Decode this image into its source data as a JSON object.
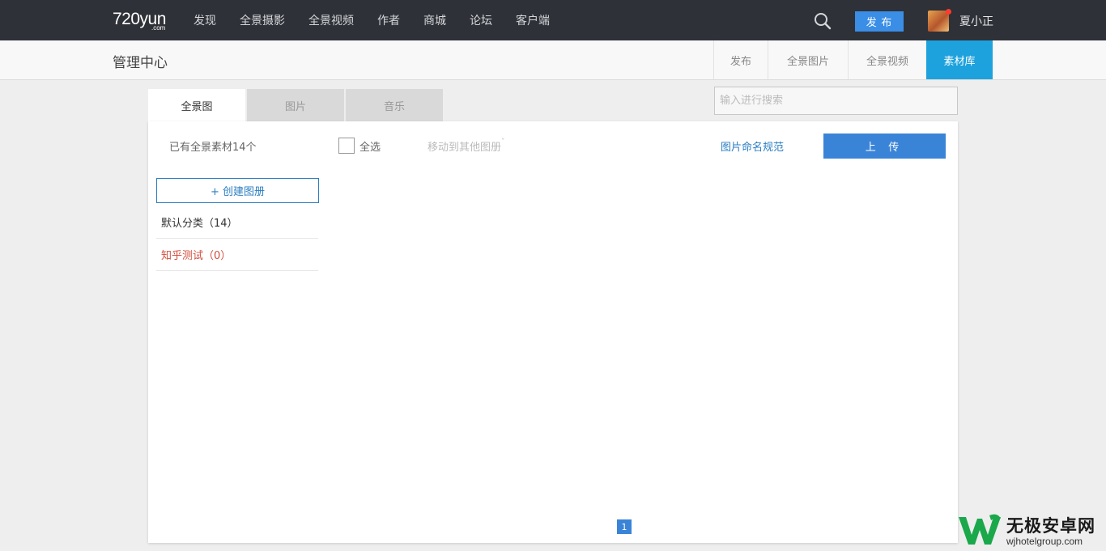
{
  "topbar": {
    "logo_main": "720yun",
    "logo_sub": ".com",
    "nav": [
      "发现",
      "全景摄影",
      "全景视频",
      "作者",
      "商城",
      "论坛",
      "客户端"
    ],
    "publish_label": "发 布",
    "username": "夏小正"
  },
  "subbar": {
    "title": "管理中心",
    "tabs": [
      "发布",
      "全景图片",
      "全景视频",
      "素材库"
    ],
    "active_tab": "素材库"
  },
  "content": {
    "tabs": [
      "全景图",
      "图片",
      "音乐"
    ],
    "active_tab": "全景图",
    "search_placeholder": "输入进行搜索",
    "count_text": "已有全景素材14个",
    "select_all": "全选",
    "move_to": "移动到其他图册",
    "naming_link": "图片命名规范",
    "upload_label": "上 传",
    "create_album": "+ 创建图册",
    "albums": [
      {
        "label": "默认分类（14）"
      },
      {
        "label": "知乎测试（0）"
      }
    ],
    "current_page": "1"
  },
  "watermark": {
    "title": "无极安卓网",
    "url": "wjhotelgroup.com"
  },
  "colors": {
    "topbar_bg": "#2e3137",
    "accent_blue": "#3a84d8",
    "active_subtab": "#1ea2dd",
    "album_red": "#d24d3c"
  }
}
